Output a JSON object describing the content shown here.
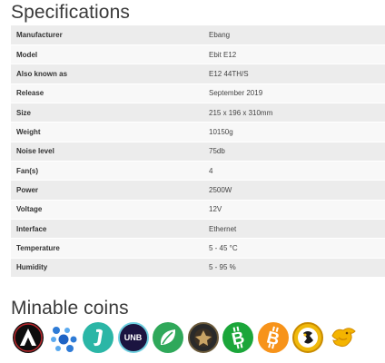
{
  "specs_title": "Specifications",
  "specs": [
    {
      "label": "Manufacturer",
      "value": "Ebang"
    },
    {
      "label": "Model",
      "value": "Ebit E12"
    },
    {
      "label": "Also known as",
      "value": "E12 44TH/S"
    },
    {
      "label": "Release",
      "value": "September 2019"
    },
    {
      "label": "Size",
      "value": "215 x 196 x 310mm"
    },
    {
      "label": "Weight",
      "value": "10150g"
    },
    {
      "label": "Noise level",
      "value": "75db"
    },
    {
      "label": "Fan(s)",
      "value": "4"
    },
    {
      "label": "Power",
      "value": "2500W"
    },
    {
      "label": "Voltage",
      "value": "12V"
    },
    {
      "label": "Interface",
      "value": "Ethernet"
    },
    {
      "label": "Temperature",
      "value": "5 - 45 °C"
    },
    {
      "label": "Humidity",
      "value": "5 - 95 %"
    }
  ],
  "coins_title": "Minable coins",
  "coins": [
    {
      "icon": "triangle-a-coin-icon",
      "bg": "#111111"
    },
    {
      "icon": "dots-coin-icon",
      "bg": "#ffffff"
    },
    {
      "icon": "j-coin-icon",
      "bg": "#2bb6a6"
    },
    {
      "icon": "unb-coin-icon",
      "bg": "#1b1440",
      "text": "UNB"
    },
    {
      "icon": "leaf-coin-icon",
      "bg": "#2fa85a"
    },
    {
      "icon": "crest-coin-icon",
      "bg": "#222222"
    },
    {
      "icon": "bitcoin-cash-icon",
      "bg": "#1ba63a"
    },
    {
      "icon": "bitcoin-icon",
      "bg": "#f7931a"
    },
    {
      "icon": "gold-coin-icon",
      "bg": "#f0b90b"
    },
    {
      "icon": "dragon-coin-icon",
      "bg": "#ffffff"
    }
  ]
}
